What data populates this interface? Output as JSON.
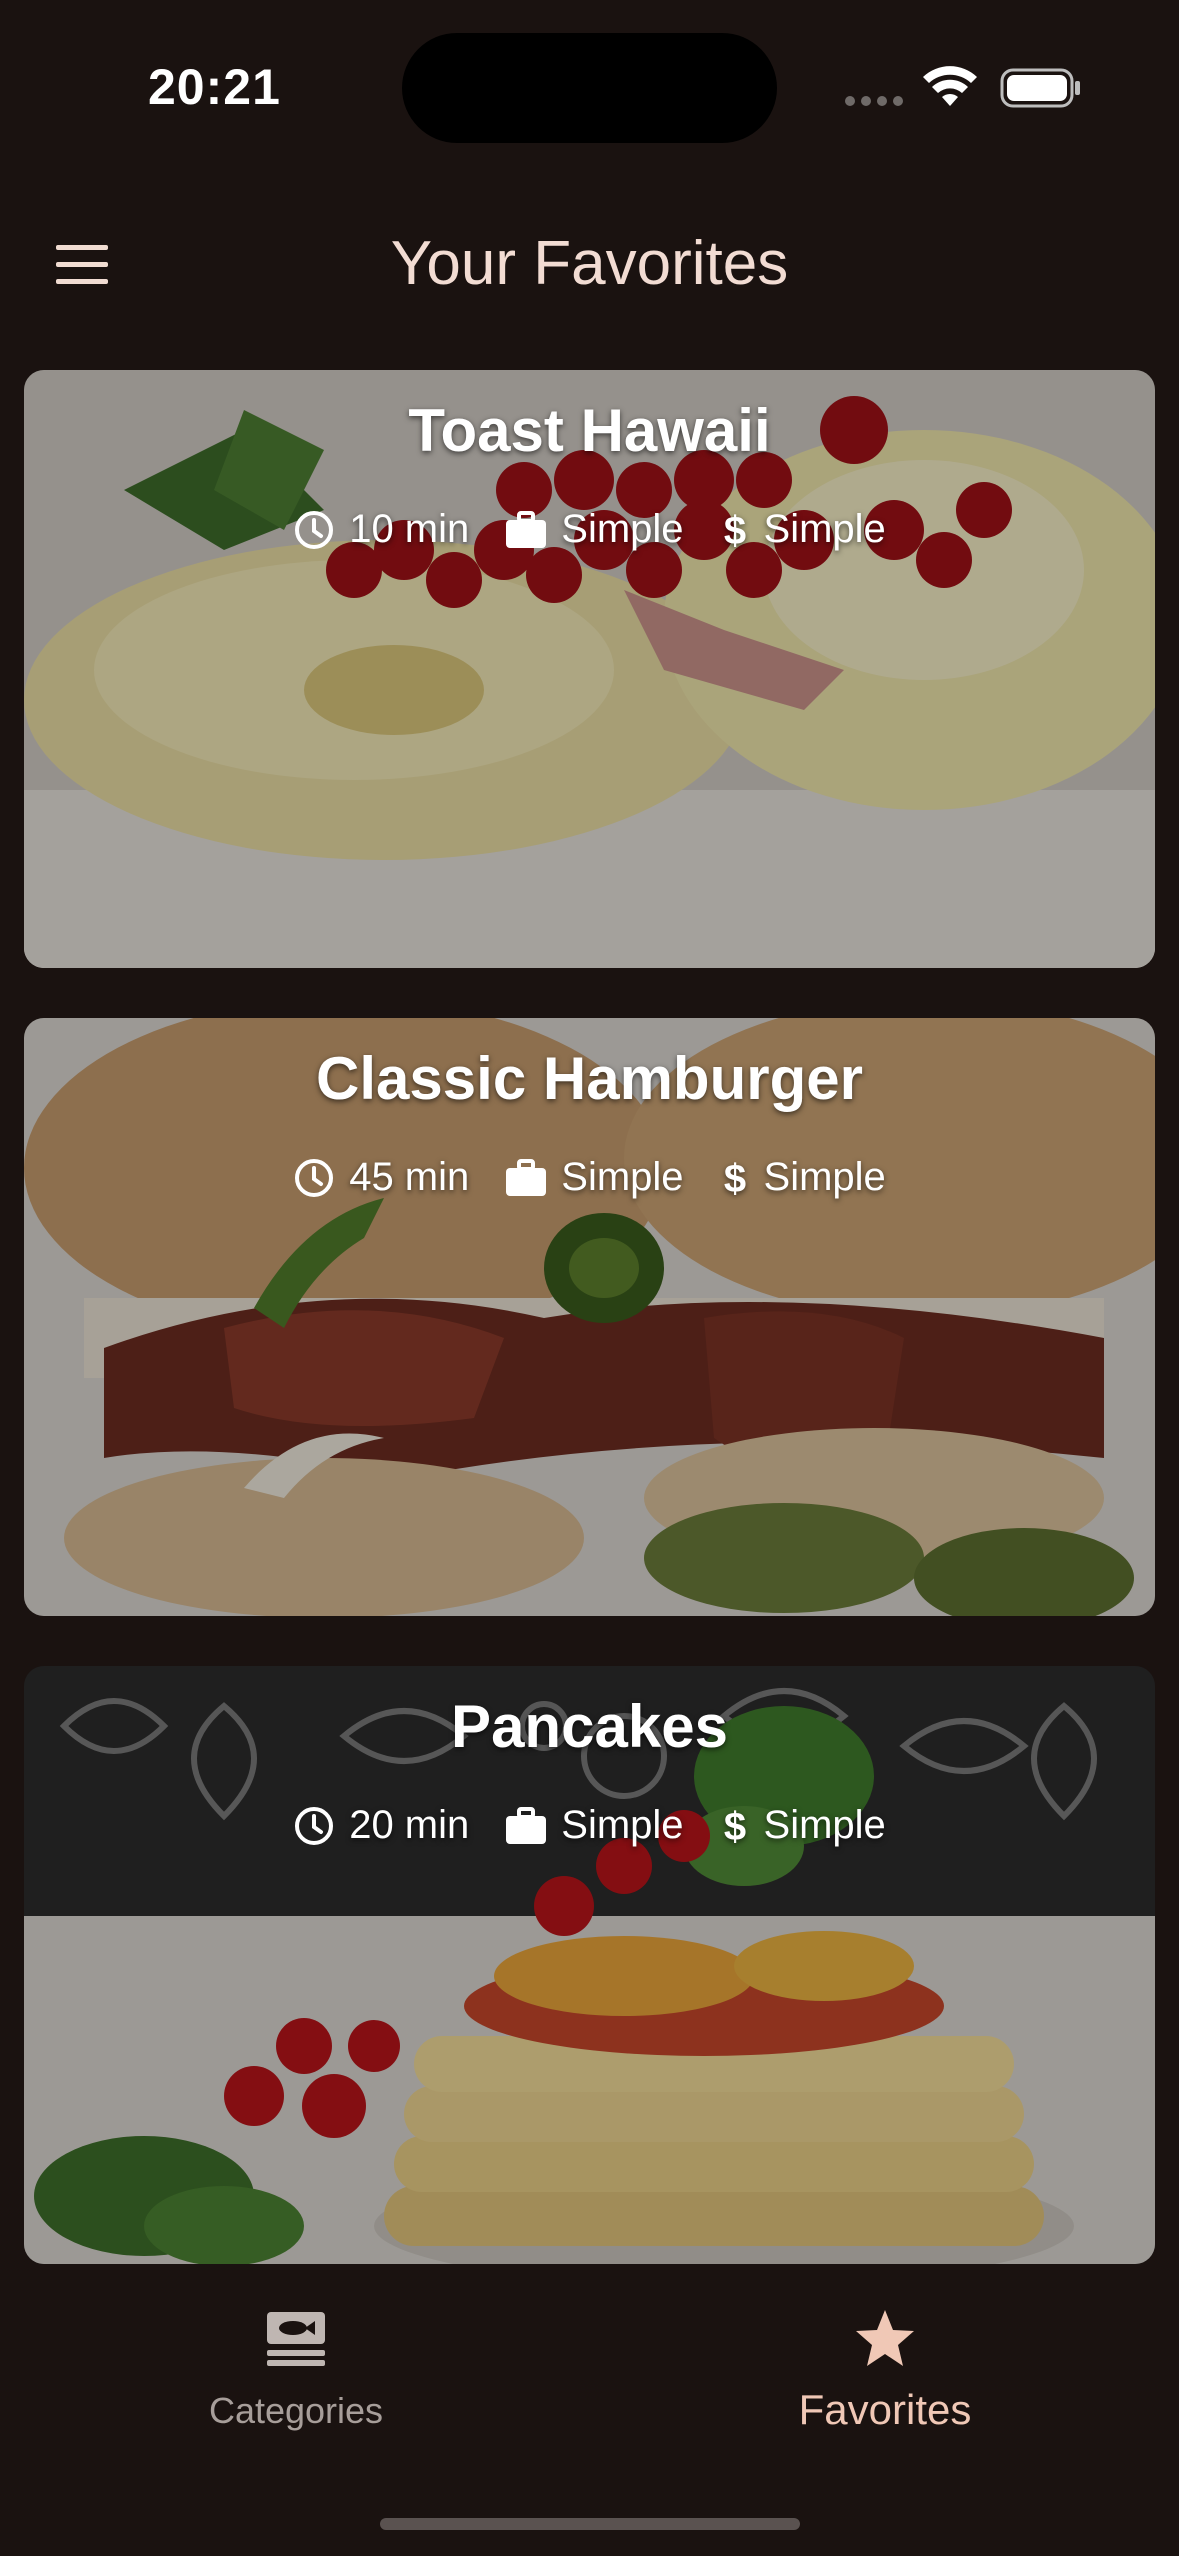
{
  "status_bar": {
    "time": "20:21"
  },
  "app_bar": {
    "title": "Your Favorites",
    "menu_icon": "hamburger-menu-icon"
  },
  "meals": [
    {
      "title": "Toast Hawaii",
      "duration": "10 min",
      "complexity": "Simple",
      "affordability": "Simple"
    },
    {
      "title": "Classic Hamburger",
      "duration": "45 min",
      "complexity": "Simple",
      "affordability": "Simple"
    },
    {
      "title": "Pancakes",
      "duration": "20 min",
      "complexity": "Simple",
      "affordability": "Simple"
    }
  ],
  "bottom_nav": {
    "items": [
      {
        "label": "Categories",
        "icon": "set-meal-icon",
        "selected": false
      },
      {
        "label": "Favorites",
        "icon": "star-icon",
        "selected": true
      }
    ]
  },
  "colors": {
    "background": "#1a1210",
    "title_text": "#f2dcd3",
    "selected_nav": "#f0c8b6",
    "unselected_nav": "#a79e9a"
  }
}
